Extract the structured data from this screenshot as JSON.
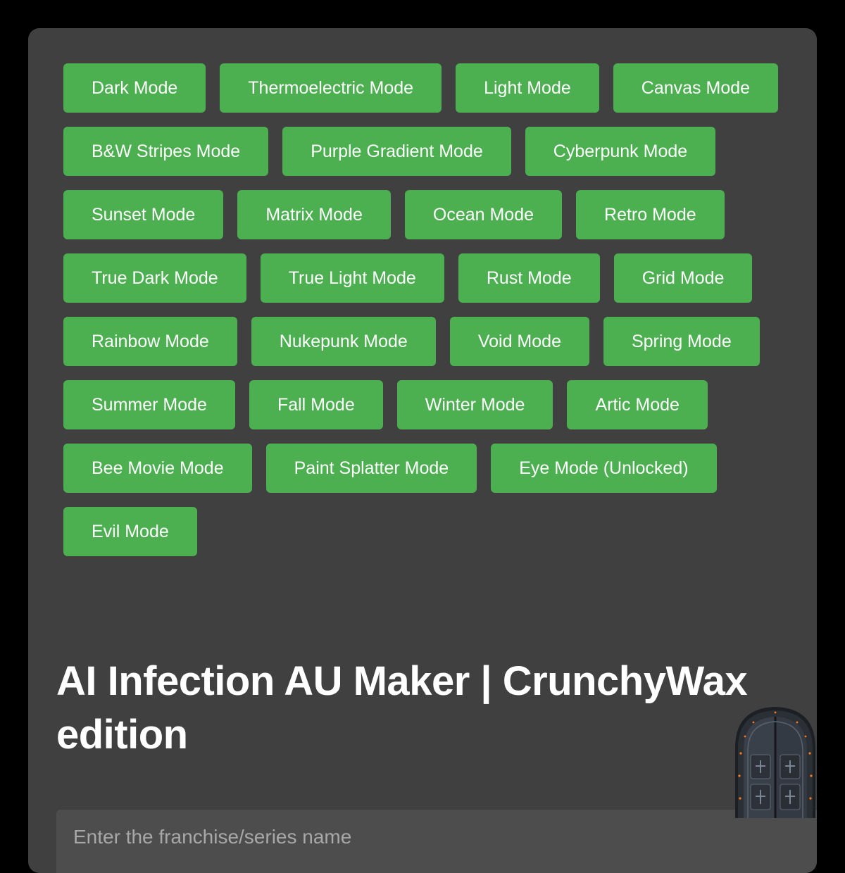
{
  "modes": [
    "Dark Mode",
    "Thermoelectric Mode",
    "Light Mode",
    "Canvas Mode",
    "B&W Stripes Mode",
    "Purple Gradient Mode",
    "Cyberpunk Mode",
    "Sunset Mode",
    "Matrix Mode",
    "Ocean Mode",
    "Retro Mode",
    "True Dark Mode",
    "True Light Mode",
    "Rust Mode",
    "Grid Mode",
    "Rainbow Mode",
    "Nukepunk Mode",
    "Void Mode",
    "Spring Mode",
    "Summer Mode",
    "Fall Mode",
    "Winter Mode",
    "Artic Mode",
    "Bee Movie Mode",
    "Paint Splatter Mode",
    "Eye Mode (Unlocked)",
    "Evil Mode"
  ],
  "title": "AI Infection AU Maker | CrunchyWax edition",
  "franchise_input": {
    "placeholder": "Enter the franchise/series name",
    "value": ""
  },
  "icons": {
    "door": "door-icon"
  },
  "colors": {
    "page_background": "#000000",
    "panel_background": "#404040",
    "button_background": "#4caf50",
    "button_text": "#ffffff",
    "title_text": "#ffffff",
    "input_background": "#4d4d4d",
    "placeholder_text": "#a8a8a8"
  }
}
